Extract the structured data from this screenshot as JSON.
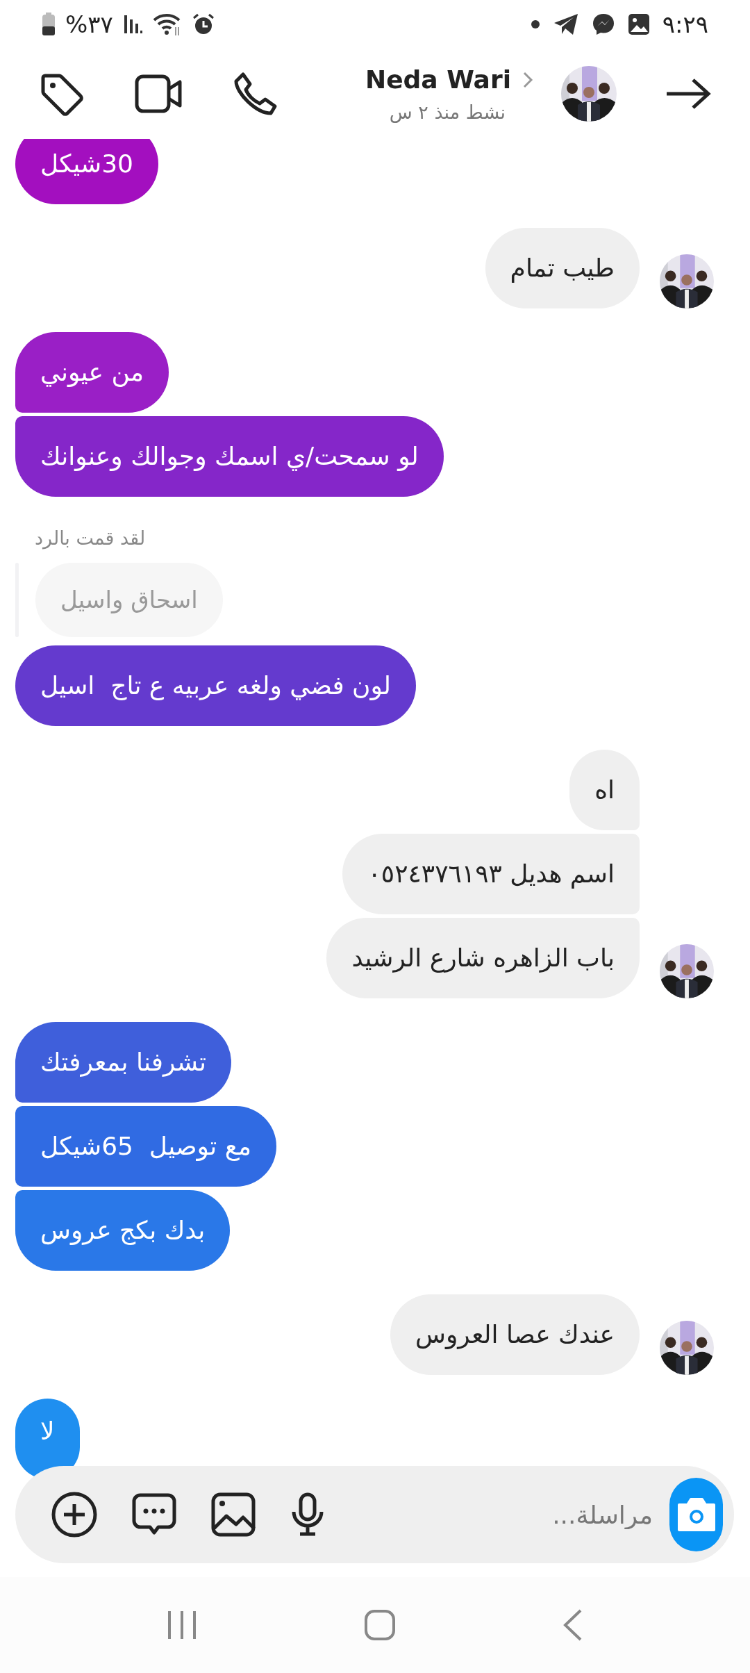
{
  "status_bar": {
    "time": "٩:٢٩",
    "battery": "%٣٧"
  },
  "header": {
    "name": "Neda Wari",
    "status": "نشط منذ ٢ س"
  },
  "messages": [
    {
      "kind": "outgoing",
      "text": "30شيكل",
      "color": "#a30fbf"
    },
    {
      "kind": "incoming",
      "text": "طيب تمام"
    },
    {
      "kind": "outgoing",
      "text": "من عيوني",
      "color": "#9a1fc6"
    },
    {
      "kind": "outgoing",
      "text": "لو سمحت/ي اسمك وجوالك وعنوانك",
      "color": "#8526c9"
    },
    {
      "kind": "reply_label",
      "text": "لقد قمت بالرد"
    },
    {
      "kind": "quoted",
      "text": "اسحاق واسيل"
    },
    {
      "kind": "outgoing",
      "text": "لون فضي ولغه عربيه ع تاج  اسيل",
      "color": "#643ace"
    },
    {
      "kind": "incoming",
      "text": "اه"
    },
    {
      "kind": "incoming",
      "text": "اسم هديل ٠٥٢٤٣٧٦١٩٣"
    },
    {
      "kind": "incoming",
      "text": "باب الزاهره شارع الرشيد"
    },
    {
      "kind": "outgoing",
      "text": "تشرفنا بمعرفتك",
      "color": "#3f5fdb"
    },
    {
      "kind": "outgoing",
      "text": "مع توصيل  65شيكل",
      "color": "#306be3"
    },
    {
      "kind": "outgoing",
      "text": "بدك بكج عروس",
      "color": "#2a78e8"
    },
    {
      "kind": "incoming",
      "text": "عندك عصا العروس"
    },
    {
      "kind": "outgoing",
      "text": "لا",
      "color": "#1f8ff0"
    }
  ],
  "composer": {
    "placeholder": "مراسلة..."
  }
}
